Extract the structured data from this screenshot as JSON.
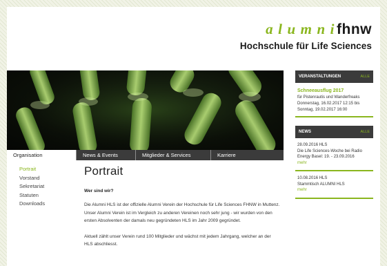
{
  "logo": {
    "alumni": "alumni",
    "fhnw": "fhnw",
    "subtitle": "Hochschule für Life Sciences"
  },
  "nav": {
    "tabs": [
      {
        "label": "Organisation",
        "active": true
      },
      {
        "label": "News & Events"
      },
      {
        "label": "Mitglieder & Services"
      },
      {
        "label": "Karriere"
      }
    ]
  },
  "leftmenu": {
    "items": [
      "Portrait",
      "Vorstand",
      "Sekretariat",
      "Statuten",
      "Downloads"
    ]
  },
  "main": {
    "title": "Portrait",
    "subhead": "Wer sind wir?",
    "paragraphs": [
      "Die Alumni HLS ist der offizielle Alumni Verein der Hochschule für Life Sciences FHNW in Muttenz. Unser Alumni Verein ist im Vergleich zu anderen Vereinen noch sehr jung - wir wurden von den ersten Absolventen der damals neu gegründeten HLS im Jahr 2009 gegründet.",
      "Aktuell zählt unser Verein rund 100 Mitglieder und wächst mit jedem Jahrgang, welcher an der HLS abschliesst."
    ]
  },
  "sidebar": {
    "events": {
      "heading": "VERANSTALTUNGEN",
      "alle": "ALLE",
      "item": {
        "title": "Schneeausflug 2017",
        "lines": [
          "für Pistenrautis und Wanderfreaks",
          "Donnerstag, 16.02.2017 12:15 bis",
          "Sonntag, 19.02.2017 16:00"
        ]
      }
    },
    "news": {
      "heading": "NEWS",
      "alle": "ALLE",
      "items": [
        {
          "date": "28.09.2016 HLS",
          "text": "Die Life Sciences-Woche bei Radio Energy Basel: 19. - 23.09.2016",
          "more": "mehr"
        },
        {
          "date": "10.08.2016 HLS",
          "text": "Stammtisch ALUMNI HLS",
          "more": "mehr"
        }
      ]
    }
  },
  "colors": {
    "accent": "#8ab61e",
    "nav_bg": "#3b3b3b",
    "text": "#333333",
    "page_bg": "#f1f3e6"
  }
}
